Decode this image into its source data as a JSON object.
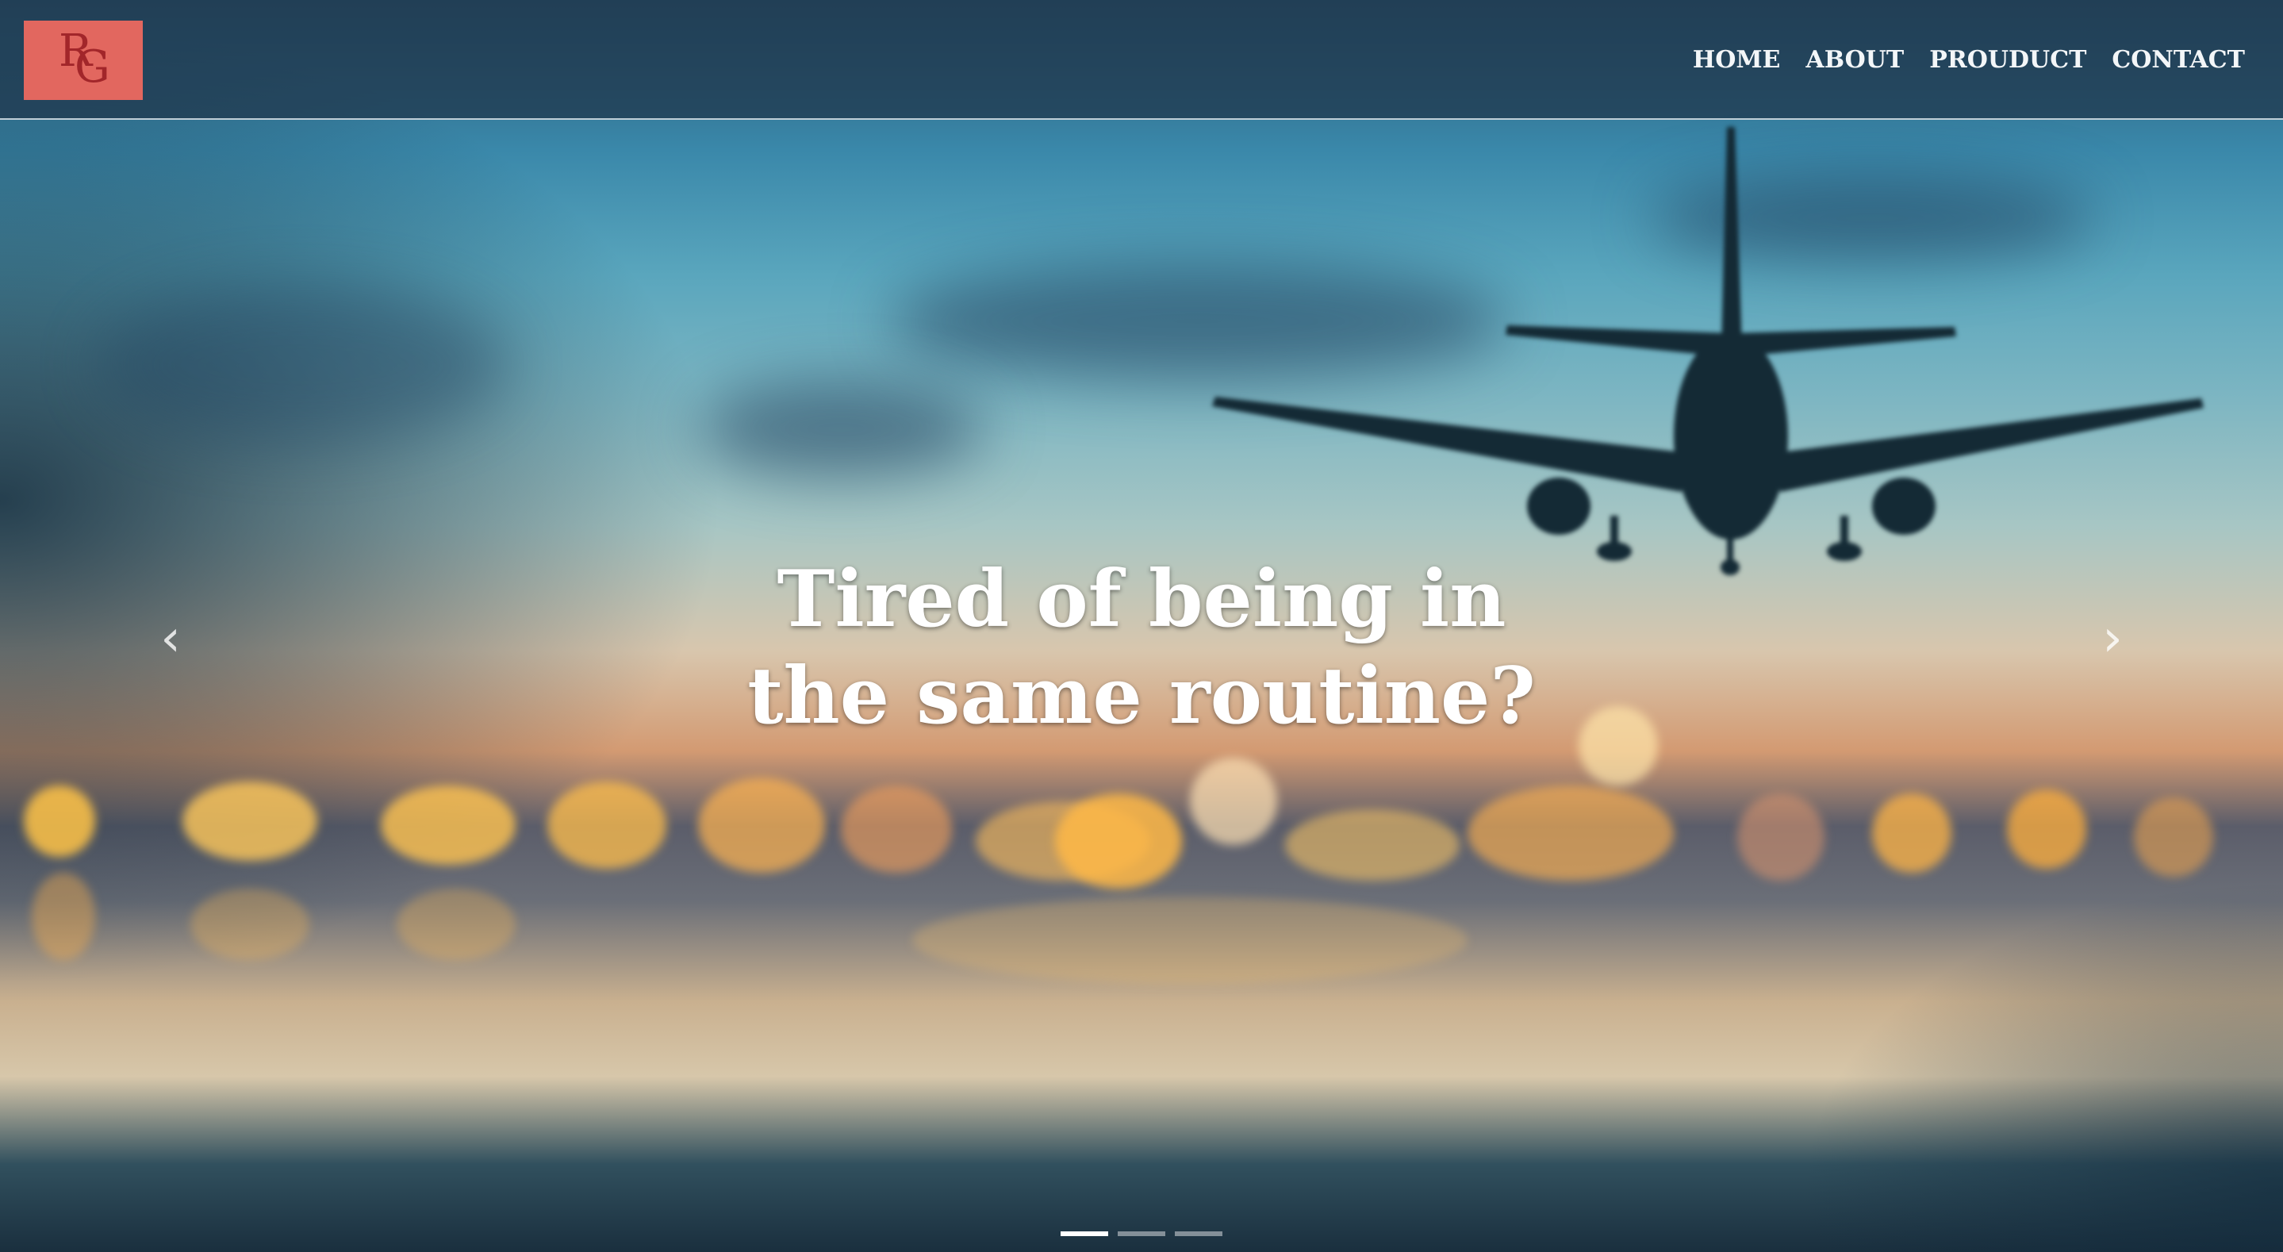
{
  "brand": {
    "logo_text_1": "R",
    "logo_text_2": "G",
    "logo_color": "#e2675f"
  },
  "nav": {
    "items": [
      {
        "label": "HOME"
      },
      {
        "label": "ABOUT"
      },
      {
        "label": "PROUDUCT"
      },
      {
        "label": "CONTACT"
      }
    ]
  },
  "hero": {
    "headline_line_1": "Tired of being in",
    "headline_line_2": "the same routine?",
    "prev_icon": "chevron-left-icon",
    "next_icon": "chevron-right-icon",
    "prev_glyph": "‹",
    "next_glyph": "›",
    "slide_count": 3,
    "active_slide": 1
  }
}
